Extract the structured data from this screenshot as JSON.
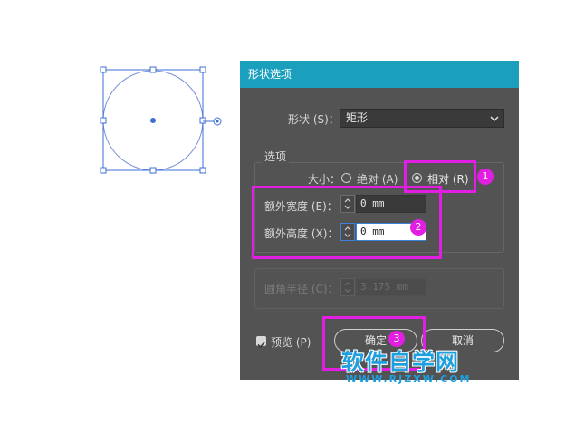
{
  "dialog": {
    "title": "形状选项",
    "shape_label": "形状 (S)：",
    "shape_value": "矩形",
    "options_group": "选项",
    "size_label": "大小：",
    "size_absolute": "绝对 (A)",
    "size_relative": "相对 (R)",
    "size_selected": "相对 (R)",
    "extra_width_label": "额外宽度 (E)：",
    "extra_width_value": "0 mm",
    "extra_height_label": "额外高度 (X)：",
    "extra_height_value": "0 mm",
    "corner_radius_label": "圆角半径 (C)：",
    "corner_radius_value": "3.175 mm",
    "preview_label": "预览 (P)",
    "preview_checked": true,
    "ok_label": "确定",
    "cancel_label": "取消"
  },
  "annotations": {
    "badge_1": "1",
    "badge_2": "2",
    "badge_3": "3",
    "color": "#e21ee3"
  },
  "watermark": {
    "title": "软件自学网",
    "url": "WWW.RJZXW.COM"
  },
  "colors": {
    "titlebar": "#1a9fbd",
    "dialog_bg": "#535353",
    "selection": "#3b6fd4",
    "focus": "#3b83d9"
  }
}
